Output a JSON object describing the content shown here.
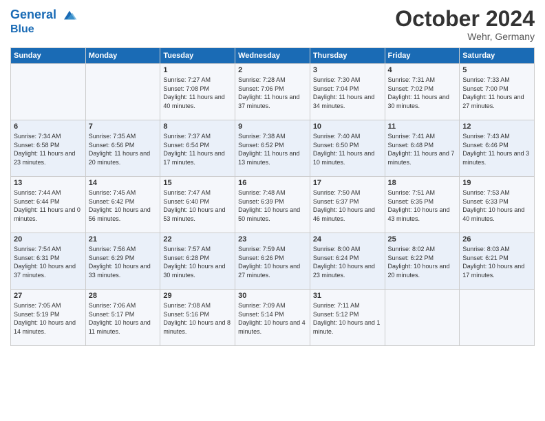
{
  "header": {
    "logo_line1": "General",
    "logo_line2": "Blue",
    "month_title": "October 2024",
    "location": "Wehr, Germany"
  },
  "columns": [
    "Sunday",
    "Monday",
    "Tuesday",
    "Wednesday",
    "Thursday",
    "Friday",
    "Saturday"
  ],
  "weeks": [
    [
      {
        "day": "",
        "info": ""
      },
      {
        "day": "",
        "info": ""
      },
      {
        "day": "1",
        "info": "Sunrise: 7:27 AM\nSunset: 7:08 PM\nDaylight: 11 hours and 40 minutes."
      },
      {
        "day": "2",
        "info": "Sunrise: 7:28 AM\nSunset: 7:06 PM\nDaylight: 11 hours and 37 minutes."
      },
      {
        "day": "3",
        "info": "Sunrise: 7:30 AM\nSunset: 7:04 PM\nDaylight: 11 hours and 34 minutes."
      },
      {
        "day": "4",
        "info": "Sunrise: 7:31 AM\nSunset: 7:02 PM\nDaylight: 11 hours and 30 minutes."
      },
      {
        "day": "5",
        "info": "Sunrise: 7:33 AM\nSunset: 7:00 PM\nDaylight: 11 hours and 27 minutes."
      }
    ],
    [
      {
        "day": "6",
        "info": "Sunrise: 7:34 AM\nSunset: 6:58 PM\nDaylight: 11 hours and 23 minutes."
      },
      {
        "day": "7",
        "info": "Sunrise: 7:35 AM\nSunset: 6:56 PM\nDaylight: 11 hours and 20 minutes."
      },
      {
        "day": "8",
        "info": "Sunrise: 7:37 AM\nSunset: 6:54 PM\nDaylight: 11 hours and 17 minutes."
      },
      {
        "day": "9",
        "info": "Sunrise: 7:38 AM\nSunset: 6:52 PM\nDaylight: 11 hours and 13 minutes."
      },
      {
        "day": "10",
        "info": "Sunrise: 7:40 AM\nSunset: 6:50 PM\nDaylight: 11 hours and 10 minutes."
      },
      {
        "day": "11",
        "info": "Sunrise: 7:41 AM\nSunset: 6:48 PM\nDaylight: 11 hours and 7 minutes."
      },
      {
        "day": "12",
        "info": "Sunrise: 7:43 AM\nSunset: 6:46 PM\nDaylight: 11 hours and 3 minutes."
      }
    ],
    [
      {
        "day": "13",
        "info": "Sunrise: 7:44 AM\nSunset: 6:44 PM\nDaylight: 11 hours and 0 minutes."
      },
      {
        "day": "14",
        "info": "Sunrise: 7:45 AM\nSunset: 6:42 PM\nDaylight: 10 hours and 56 minutes."
      },
      {
        "day": "15",
        "info": "Sunrise: 7:47 AM\nSunset: 6:40 PM\nDaylight: 10 hours and 53 minutes."
      },
      {
        "day": "16",
        "info": "Sunrise: 7:48 AM\nSunset: 6:39 PM\nDaylight: 10 hours and 50 minutes."
      },
      {
        "day": "17",
        "info": "Sunrise: 7:50 AM\nSunset: 6:37 PM\nDaylight: 10 hours and 46 minutes."
      },
      {
        "day": "18",
        "info": "Sunrise: 7:51 AM\nSunset: 6:35 PM\nDaylight: 10 hours and 43 minutes."
      },
      {
        "day": "19",
        "info": "Sunrise: 7:53 AM\nSunset: 6:33 PM\nDaylight: 10 hours and 40 minutes."
      }
    ],
    [
      {
        "day": "20",
        "info": "Sunrise: 7:54 AM\nSunset: 6:31 PM\nDaylight: 10 hours and 37 minutes."
      },
      {
        "day": "21",
        "info": "Sunrise: 7:56 AM\nSunset: 6:29 PM\nDaylight: 10 hours and 33 minutes."
      },
      {
        "day": "22",
        "info": "Sunrise: 7:57 AM\nSunset: 6:28 PM\nDaylight: 10 hours and 30 minutes."
      },
      {
        "day": "23",
        "info": "Sunrise: 7:59 AM\nSunset: 6:26 PM\nDaylight: 10 hours and 27 minutes."
      },
      {
        "day": "24",
        "info": "Sunrise: 8:00 AM\nSunset: 6:24 PM\nDaylight: 10 hours and 23 minutes."
      },
      {
        "day": "25",
        "info": "Sunrise: 8:02 AM\nSunset: 6:22 PM\nDaylight: 10 hours and 20 minutes."
      },
      {
        "day": "26",
        "info": "Sunrise: 8:03 AM\nSunset: 6:21 PM\nDaylight: 10 hours and 17 minutes."
      }
    ],
    [
      {
        "day": "27",
        "info": "Sunrise: 7:05 AM\nSunset: 5:19 PM\nDaylight: 10 hours and 14 minutes."
      },
      {
        "day": "28",
        "info": "Sunrise: 7:06 AM\nSunset: 5:17 PM\nDaylight: 10 hours and 11 minutes."
      },
      {
        "day": "29",
        "info": "Sunrise: 7:08 AM\nSunset: 5:16 PM\nDaylight: 10 hours and 8 minutes."
      },
      {
        "day": "30",
        "info": "Sunrise: 7:09 AM\nSunset: 5:14 PM\nDaylight: 10 hours and 4 minutes."
      },
      {
        "day": "31",
        "info": "Sunrise: 7:11 AM\nSunset: 5:12 PM\nDaylight: 10 hours and 1 minute."
      },
      {
        "day": "",
        "info": ""
      },
      {
        "day": "",
        "info": ""
      }
    ]
  ]
}
